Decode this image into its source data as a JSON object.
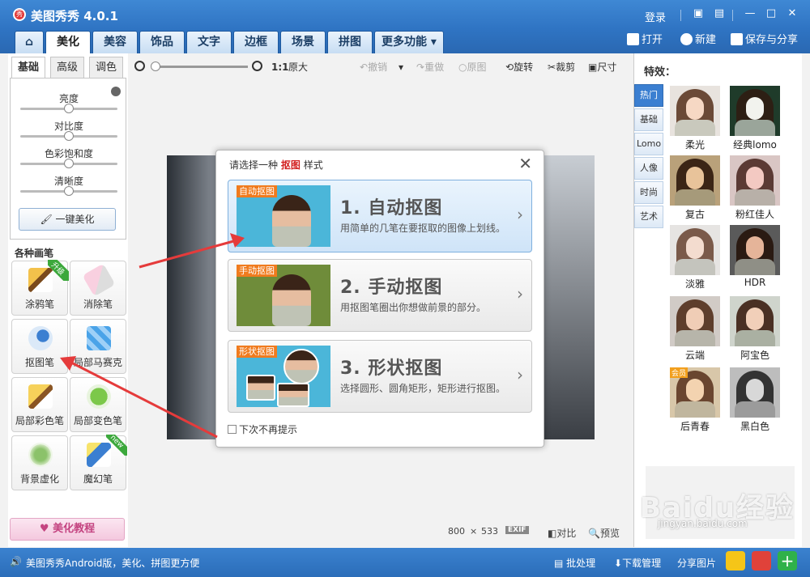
{
  "window": {
    "title": "美图秀秀 4.0.1",
    "logo_text": "秀",
    "login": "登录"
  },
  "tabs": [
    "美化",
    "美容",
    "饰品",
    "文字",
    "边框",
    "场景",
    "拼图",
    "更多功能"
  ],
  "top_actions": {
    "open": "打开",
    "new": "新建",
    "save": "保存与分享"
  },
  "left": {
    "subtabs": [
      "基础",
      "高级",
      "调色"
    ],
    "sliders": [
      {
        "label": "亮度",
        "value": 0.5
      },
      {
        "label": "对比度",
        "value": 0.5
      },
      {
        "label": "色彩饱和度",
        "value": 0.5
      },
      {
        "label": "清晰度",
        "value": 0.5
      }
    ],
    "one_click": "一键美化",
    "section_title": "各种画笔",
    "brushes": [
      {
        "label": "涂鸦笔",
        "ribbon": "升级"
      },
      {
        "label": "消除笔",
        "ribbon": ""
      },
      {
        "label": "抠图笔",
        "ribbon": ""
      },
      {
        "label": "局部马赛克",
        "ribbon": ""
      },
      {
        "label": "局部彩色笔",
        "ribbon": ""
      },
      {
        "label": "局部变色笔",
        "ribbon": ""
      },
      {
        "label": "背景虚化",
        "ribbon": ""
      },
      {
        "label": "魔幻笔",
        "ribbon": "new"
      }
    ],
    "tutorial": "美化教程"
  },
  "toolbar": {
    "zoom_label": "1:1",
    "original_size": "原大",
    "undo": "撤销",
    "redo": "重做",
    "original": "原图",
    "rotate": "旋转",
    "crop": "裁剪",
    "resize": "尺寸"
  },
  "dialog": {
    "title_prefix": "请选择一种",
    "title_highlight": "抠图",
    "title_suffix": "样式",
    "options": [
      {
        "badge": "自动抠图",
        "title": "1. 自动抠图",
        "desc": "用简单的几笔在要抠取的图像上划线。"
      },
      {
        "badge": "手动抠图",
        "title": "2. 手动抠图",
        "desc": "用抠图笔圈出你想做前景的部分。"
      },
      {
        "badge": "形状抠图",
        "title": "3. 形状抠图",
        "desc": "选择圆形、圆角矩形，矩形进行抠图。"
      }
    ],
    "dont_show": "下次不再提示"
  },
  "right": {
    "title": "特效：",
    "categories": [
      "热门",
      "基础",
      "Lomo",
      "人像",
      "时尚",
      "艺术"
    ],
    "effects": [
      "柔光",
      "经典lomo",
      "复古",
      "粉红佳人",
      "淡雅",
      "HDR",
      "云端",
      "阿宝色",
      "后青春",
      "黑白色"
    ],
    "effect_badge": "会员"
  },
  "canvas_info": {
    "width": "800",
    "times": "×",
    "height": "533",
    "exif": "EXIF",
    "compare": "对比",
    "preview": "预览"
  },
  "status": {
    "promo": "美图秀秀Android版，美化、拼图更方便",
    "batch": "批处理",
    "download": "下载管理",
    "share": "分享图片"
  },
  "watermark": {
    "brand": "Baidu经验",
    "url": "jingyan.baidu.com"
  },
  "colors": {
    "titlebar": "#2f74c3",
    "accent_red": "#d21f1f",
    "arrow": "#e53b3b",
    "pink": "#c44380"
  }
}
